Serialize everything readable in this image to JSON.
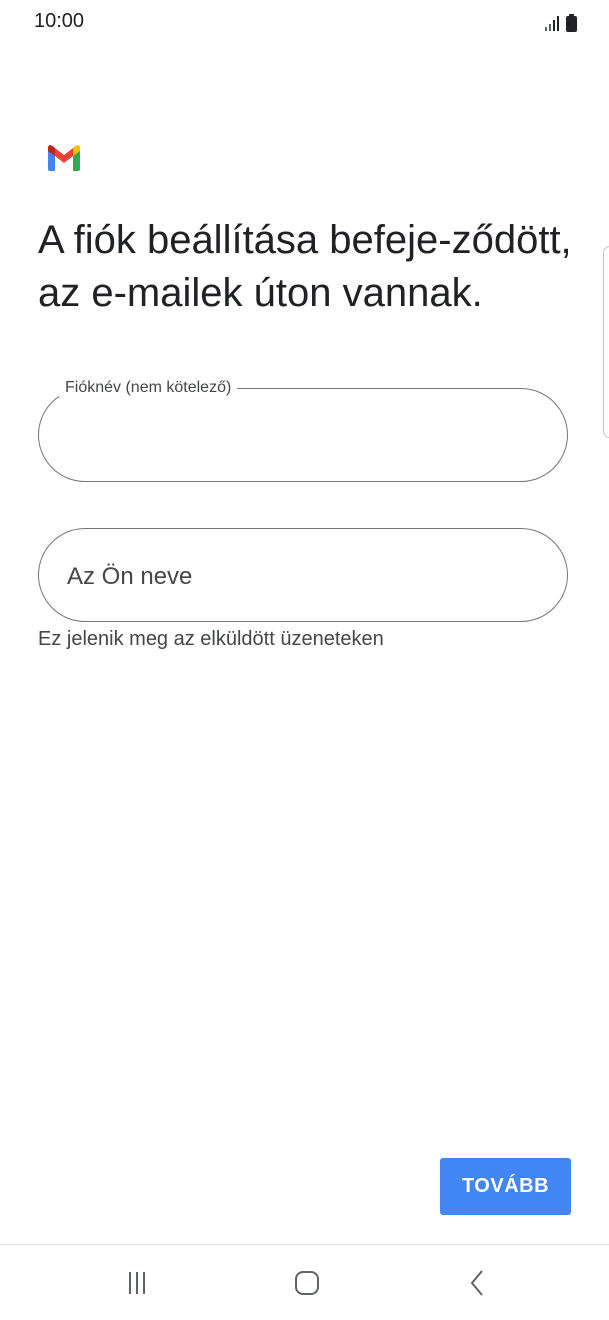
{
  "status_bar": {
    "time": "10:00",
    "signal_icon": "signal-icon",
    "battery_icon": "battery-icon"
  },
  "header": {
    "logo_icon": "gmail-logo-icon",
    "title": "A fiók beállítása befeje-ződött, az e-mailek úton vannak."
  },
  "form": {
    "account_name": {
      "label": "Fióknév (nem kötelező)",
      "value": ""
    },
    "your_name": {
      "placeholder": "Az Ön neve",
      "value": "",
      "helper": "Ez jelenik meg az elküldött üzeneteken"
    }
  },
  "actions": {
    "next_label": "TOVÁBB"
  },
  "navigation": {
    "recents_icon": "recents-icon",
    "home_icon": "home-icon",
    "back_icon": "back-icon"
  },
  "colors": {
    "accent": "#4285f4",
    "field_border": "#747775",
    "text_primary": "#202124",
    "text_secondary": "#444746"
  }
}
